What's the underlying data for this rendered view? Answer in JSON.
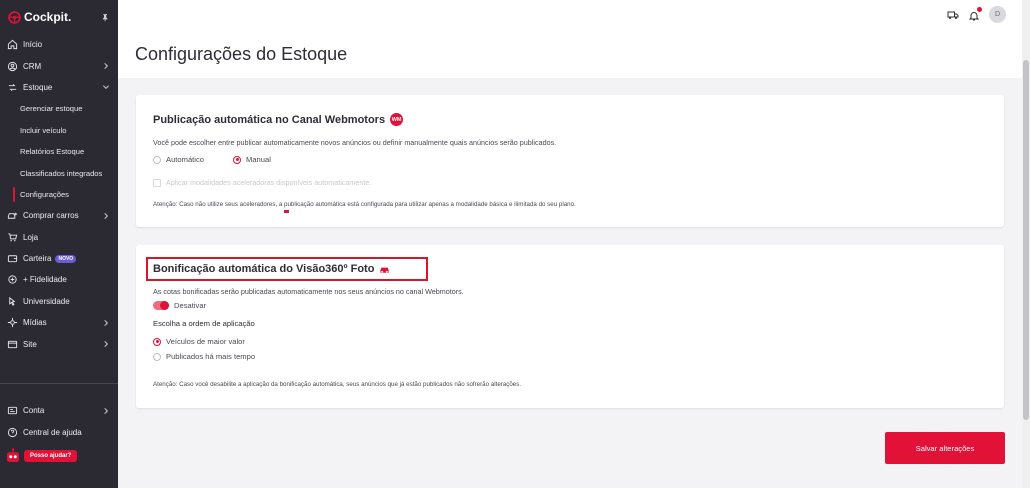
{
  "app": {
    "name": "Cockpit."
  },
  "sidebar": {
    "items": [
      {
        "label": "Início",
        "icon": "home-icon",
        "chevron": false
      },
      {
        "label": "CRM",
        "icon": "crm-icon",
        "chevron": true
      },
      {
        "label": "Estoque",
        "icon": "stock-icon",
        "chevron": true,
        "expanded": true
      }
    ],
    "sub_items": [
      {
        "label": "Gerenciar estoque"
      },
      {
        "label": "Incluir veículo"
      },
      {
        "label": "Relatórios Estoque"
      },
      {
        "label": "Classificados integrados"
      },
      {
        "label": "Configurações",
        "active": true
      }
    ],
    "items2": [
      {
        "label": "Comprar carros",
        "icon": "car-buy-icon",
        "chevron": true
      },
      {
        "label": "Loja",
        "icon": "cart-icon",
        "chevron": false
      },
      {
        "label": "Carteira",
        "icon": "wallet-icon",
        "chevron": false,
        "badge": "NOVO"
      },
      {
        "label": "+ Fidelidade",
        "icon": "fidelity-icon",
        "chevron": false
      },
      {
        "label": "Universidade",
        "icon": "university-icon",
        "chevron": false
      },
      {
        "label": "Mídias",
        "icon": "media-icon",
        "chevron": true
      },
      {
        "label": "Site",
        "icon": "site-icon",
        "chevron": true
      }
    ],
    "bottom_items": [
      {
        "label": "Conta",
        "icon": "account-icon",
        "chevron": true
      },
      {
        "label": "Central de ajuda",
        "icon": "help-icon",
        "chevron": false
      }
    ],
    "help_button": "Posso ajudar?"
  },
  "topbar": {
    "avatar_initial": "D"
  },
  "page": {
    "title": "Configurações do Estoque"
  },
  "card1": {
    "title": "Publicação automática no Canal Webmotors",
    "badge": "WM",
    "description": "Você pode escolher entre publicar automaticamente novos anúncios ou definir manualmente quais anúncios serão publicados.",
    "options": [
      {
        "label": "Automático",
        "selected": false
      },
      {
        "label": "Manual",
        "selected": true
      }
    ],
    "checkbox_label": "Aplicar modalidades aceleradoras disponíveis automaticamente.",
    "note": "Atenção: Caso não utilize seus aceleradores, a publicação automática está configurada para utilizar apenas a modalidade básica e ilimitada do seu plano."
  },
  "card2": {
    "title": "Bonificação automática do Visão360º Foto",
    "description": "As cotas bonificadas serão publicadas automaticamente nos seus anúncios no canal Webmotors.",
    "toggle_label": "Desativar",
    "order_label": "Escolha a ordem de aplicação",
    "options": [
      {
        "label": "Veículos de maior valor",
        "selected": true
      },
      {
        "label": "Publicados há mais tempo",
        "selected": false
      }
    ],
    "note": "Atenção: Caso você desabilite a aplicação da bonificação automática, seus anúncios que já estão publicados não sofrerão alterações."
  },
  "actions": {
    "save_label": "Salvar alterações"
  },
  "colors": {
    "accent": "#e11138",
    "sidebar_bg": "#2b2a33",
    "badge_new": "#6b5bd6"
  }
}
